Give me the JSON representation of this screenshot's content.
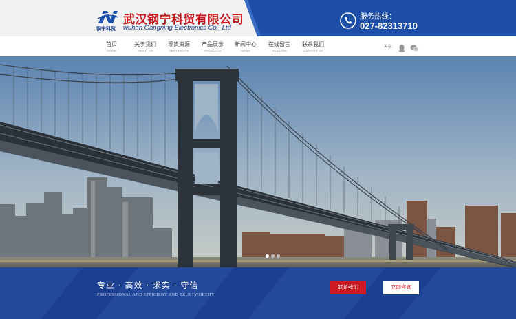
{
  "header": {
    "logo_sub": "钢宁科贸",
    "company_cn": "武汉钢宁科贸有限公司",
    "company_en": "wuhan Gangning Electronics Co., Ltd",
    "hotline_label": "服务热线：",
    "hotline_number": "027-82313710",
    "colors": {
      "brand_blue": "#1d4fa8",
      "brand_red": "#c8161d"
    }
  },
  "nav": {
    "items": [
      {
        "cn": "首页",
        "en": "HOME"
      },
      {
        "cn": "关于我们",
        "en": "ABOUT US"
      },
      {
        "cn": "现货资源",
        "en": "CERTIFICATE"
      },
      {
        "cn": "产品展示",
        "en": "PRODUCTS"
      },
      {
        "cn": "新闻中心",
        "en": "NEWS"
      },
      {
        "cn": "在线留言",
        "en": "MESSAGE"
      },
      {
        "cn": "联系我们",
        "en": "CONTACT US"
      }
    ],
    "follow_label": "关注：",
    "social_icons": [
      "qq-icon",
      "wechat-icon"
    ]
  },
  "banner": {
    "slide_count": 3,
    "active_slide": 1,
    "image_subject": "suspension bridge over river with city skyline"
  },
  "slogan": {
    "cn": "专业 · 高效 · 求实 · 守信",
    "en": "PROFESSIONAL AND EFFICIENT AND TRUSTWORTHY",
    "contact_button": "联系我们",
    "consult_button": "立即咨询"
  }
}
